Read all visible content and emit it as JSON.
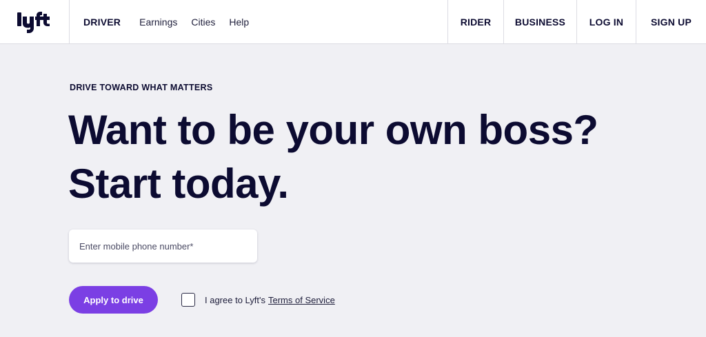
{
  "brand": {
    "logo_icon": "lyft-logo",
    "logo_text": "lyft",
    "color": "#0c0b31"
  },
  "header": {
    "left_nav": [
      {
        "label": "DRIVER"
      },
      {
        "label": "Earnings"
      },
      {
        "label": "Cities"
      },
      {
        "label": "Help"
      }
    ],
    "right_nav": {
      "rider": "RIDER",
      "business": "BUSINESS",
      "login": "LOG IN",
      "signup": "SIGN UP"
    }
  },
  "hero": {
    "eyebrow": "DRIVE TOWARD WHAT MATTERS",
    "headline_line1": "Want to be your own boss?",
    "headline_line2": "Start today.",
    "phone_placeholder": "Enter mobile phone number*",
    "phone_value": "",
    "apply_label": "Apply to drive",
    "agree_text": "I agree to Lyft's",
    "tos_label": "Terms of Service",
    "agree_checked": false
  },
  "colors": {
    "accent": "#7b3fe4",
    "background": "#f0f0f4",
    "text": "#0c0b31"
  }
}
